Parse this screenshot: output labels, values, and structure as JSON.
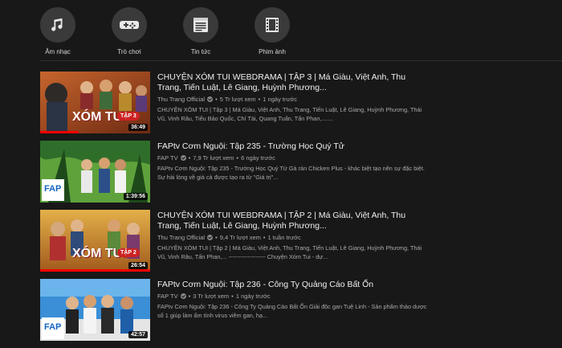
{
  "categories": [
    {
      "label": "Âm nhạc",
      "icon": "music-note-icon"
    },
    {
      "label": "Trò chơi",
      "icon": "gamepad-icon"
    },
    {
      "label": "Tin tức",
      "icon": "newspaper-icon"
    },
    {
      "label": "Phim ảnh",
      "icon": "film-strip-icon"
    }
  ],
  "videos": [
    {
      "title": "CHUYỆN XÓM TUI WEBDRAMA | TẬP 3 | Má Giàu, Việt Anh, Thu Trang, Tiến Luật, Lê Giang, Huỳnh Phương...",
      "channel": "Thu Trang Official",
      "views": "5 Tr lượt xem",
      "age": "1 ngày trước",
      "description": "CHUYỆN XÓM TUI | Tập 3 | Má Giàu, Việt Anh, Thu Trang, Tiến Luật, Lê Giang, Huỳnh Phương, Thái Vũ, Vinh Râu, Tiểu Bảo Quốc, Chí Tài, Quang Tuấn, Tấn Phan,.......",
      "duration": "36:49",
      "thumb_text": "XÓM TUI",
      "episode": "TẬP 3",
      "watched": 0.35
    },
    {
      "title": "FAPtv Cơm Nguội: Tập 235 - Trường Học Quý Tử",
      "channel": "FAP TV",
      "views": "7,9 Tr lượt xem",
      "age": "6 ngày trước",
      "description": "FAPtv Cơm Nguội: Tập 235 - Trường Học Quý Tử Gà rán Chicken Plus - khác biệt tạo nên sự đặc biệt. Sự hài lòng về giá cả được tạo ra từ \"Giá trị\"...",
      "duration": "1:39:56",
      "thumb_text": "FAP",
      "episode": "",
      "watched": 0
    },
    {
      "title": "CHUYỆN XÓM TUI WEBDRAMA | TẬP 2 | Má Giàu, Việt Anh, Thu Trang, Tiến Luật, Lê Giang, Huỳnh Phương...",
      "channel": "Thu Trang Official",
      "views": "9,4 Tr lượt xem",
      "age": "1 tuần trước",
      "description": "CHUYỆN XÓM TUI | Tập 2 | Má Giàu, Việt Anh, Thu Trang, Tiến Luật, Lê Giang, Huỳnh Phương, Thái Vũ, Vinh Râu, Tấn Phan,... ------------------- Chuyện Xóm Tui - dự...",
      "duration": "26:54",
      "thumb_text": "XÓM TUI",
      "episode": "TẬP 2",
      "watched": 1
    },
    {
      "title": "FAPtv Cơm Nguội: Tập 236 - Công Ty Quảng Cáo Bất Ổn",
      "channel": "FAP TV",
      "views": "3 Tr lượt xem",
      "age": "1 ngày trước",
      "description": "FAPtv Cơm Nguội: Tập 236 - Công Ty Quảng Cáo Bất Ổn Giải độc gan Tuệ Linh - Sản phẩm thảo dược số 1 giúp làm ấm tính virus viêm gan, hạ...",
      "duration": "42:57",
      "thumb_text": "FAP",
      "episode": "",
      "watched": 0
    }
  ]
}
